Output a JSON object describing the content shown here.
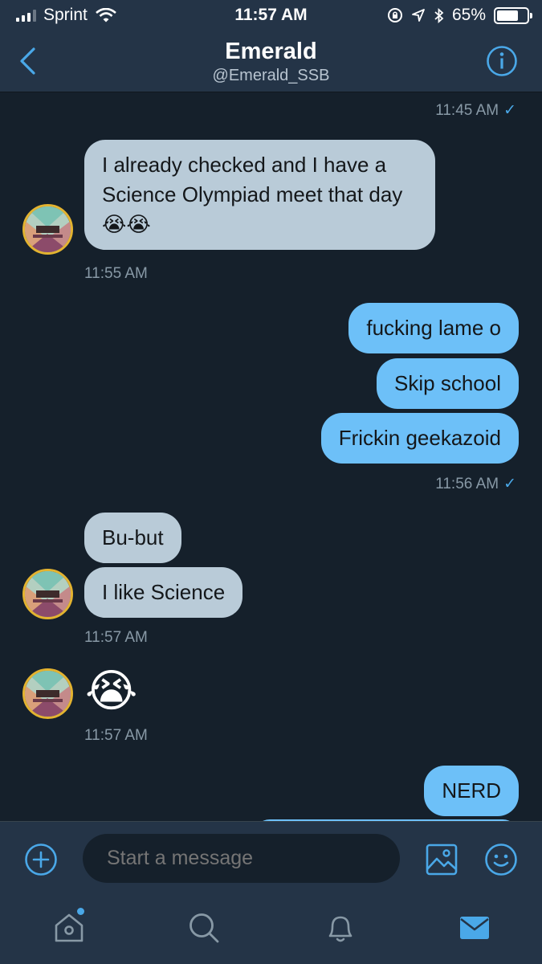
{
  "status_bar": {
    "carrier": "Sprint",
    "time": "11:57 AM",
    "battery": "65%",
    "battery_level": 0.65
  },
  "header": {
    "title": "Emerald",
    "handle": "@Emerald_SSB"
  },
  "messages": [
    {
      "ts": "11:45 AM",
      "read_mark": "✓"
    },
    {
      "text": "I already checked and I have a Science Olympiad meet that day 😭😭",
      "ts": "11:55 AM"
    },
    {
      "bubbles": [
        "fucking lame o",
        "Skip school",
        "Frickin geekazoid"
      ],
      "ts": "11:56 AM",
      "read_mark": "✓"
    },
    {
      "bubbles": [
        "Bu-but",
        "I like Science"
      ],
      "ts": "11:57 AM"
    },
    {
      "emoji": "😭",
      "ts": "11:57 AM"
    },
    {
      "bubbles": [
        "NERD"
      ]
    }
  ],
  "composer": {
    "placeholder": "Start a message"
  },
  "colors": {
    "background": "#15202b",
    "bar": "#243447",
    "accent": "#4aa8e8",
    "incoming": "#b9cbd8",
    "outgoing": "#6dc0f8"
  },
  "icons": [
    "back-chevron-icon",
    "info-icon",
    "add-icon",
    "gallery-icon",
    "emoji-icon",
    "home-icon",
    "search-icon",
    "notifications-icon",
    "messages-icon"
  ]
}
